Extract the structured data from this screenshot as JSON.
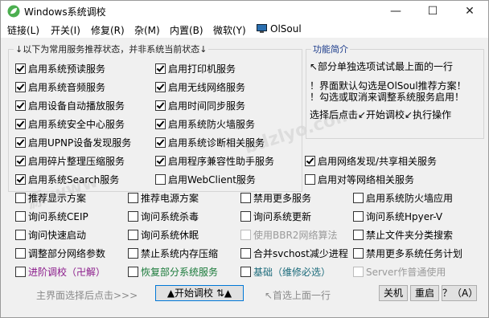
{
  "window": {
    "title": "Windows系统调校",
    "minimize": "—",
    "maximize": "☐",
    "close": "✕"
  },
  "menu": [
    "链接(L)",
    "开关(I)",
    "修复(R)",
    "杂(M)",
    "内置(B)",
    "微软(Y)"
  ],
  "menu_brand": "OlSoul",
  "group_main": {
    "legend": "↓以下为常用服务推荐状态，并非系统当前状态↓"
  },
  "group_info": {
    "legend": "功能简介",
    "line1": "↖部分单独选项试试最上面的一行",
    "line2": "！界面默认勾选是OlSoul推荐方案！",
    "line3": "！勾选或取消来调整系统服务启用！",
    "line4": "选择后点击↙开始调校↙执行操作"
  },
  "checks": [
    {
      "label": "启用系统预读服务",
      "checked": true
    },
    {
      "label": "启用打印机服务",
      "checked": true
    },
    {
      "label": "启用系统音频服务",
      "checked": true
    },
    {
      "label": "启用无线网络服务",
      "checked": true
    },
    {
      "label": "启用设备自动播放服务",
      "checked": true
    },
    {
      "label": "启用时间同步服务",
      "checked": true
    },
    {
      "label": "启用系统安全中心服务",
      "checked": true
    },
    {
      "label": "启用系统防火墙服务",
      "checked": true
    },
    {
      "label": "启用UPNP设备发现服务",
      "checked": true
    },
    {
      "label": "启用系统诊断相关服务",
      "checked": true
    },
    {
      "label": "启用碎片整理压缩服务",
      "checked": true
    },
    {
      "label": "启用程序兼容性助手服务",
      "checked": true
    },
    {
      "label": "启用网络发现/共享相关服务",
      "checked": true
    },
    {
      "label": "启用系统Search服务",
      "checked": true
    },
    {
      "label": "启用WebClient服务",
      "checked": false
    },
    {
      "label": "启用对等网络相关服务",
      "checked": false
    },
    {
      "label": "推荐显示方案",
      "checked": false
    },
    {
      "label": "推荐电源方案",
      "checked": false
    },
    {
      "label": "禁用更多服务",
      "checked": false
    },
    {
      "label": "启用系统防火墙应用",
      "checked": false
    },
    {
      "label": "询问系统CEIP",
      "checked": false
    },
    {
      "label": "询问系统杀毒",
      "checked": false
    },
    {
      "label": "询问系统更新",
      "checked": false
    },
    {
      "label": "询问系统Hpyer-V",
      "checked": false
    },
    {
      "label": "询问快速启动",
      "checked": false
    },
    {
      "label": "询问系统休眠",
      "checked": false
    },
    {
      "label": "使用BBR2网络算法",
      "checked": false
    },
    {
      "label": "禁止文件夹分类搜索",
      "checked": false
    },
    {
      "label": "调整部分网络参数",
      "checked": false
    },
    {
      "label": "禁止系统内存压缩",
      "checked": false
    },
    {
      "label": "合并svchost减少进程",
      "checked": false
    },
    {
      "label": "禁用更多系统任务计划",
      "checked": false
    },
    {
      "label": "进阶调校（卍解）",
      "checked": false
    },
    {
      "label": "恢复部分系统服务",
      "checked": false
    },
    {
      "label": "基础（维修必选）",
      "checked": false
    },
    {
      "label": "Server作普通使用",
      "checked": false
    }
  ],
  "bottom": {
    "hint_left": "主界面选择后点击>>>",
    "start_button": "▲开始调校 ⇅▲",
    "hint_right": "↖首选上面一行",
    "shutdown": "关机",
    "restart": "重启",
    "help": "？（A）"
  },
  "colors": {
    "accent": "#0078d7",
    "checked": "#000000",
    "disabled": "#9a9a9a"
  }
}
